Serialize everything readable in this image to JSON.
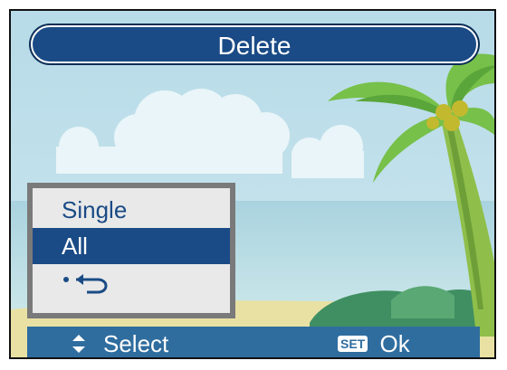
{
  "header": {
    "title": "Delete"
  },
  "menu": {
    "items": [
      {
        "label": "Single",
        "selected": false
      },
      {
        "label": "All",
        "selected": true
      },
      {
        "label": "",
        "icon": "back-icon",
        "selected": false
      }
    ]
  },
  "footer": {
    "select_icon": "up-down-arrow-icon",
    "select_label": "Select",
    "set_badge": "SET",
    "ok_label": "Ok"
  },
  "colors": {
    "accent": "#1a4b86",
    "bar": "#2f6d9f",
    "menu_bg": "#e9e9e9"
  }
}
